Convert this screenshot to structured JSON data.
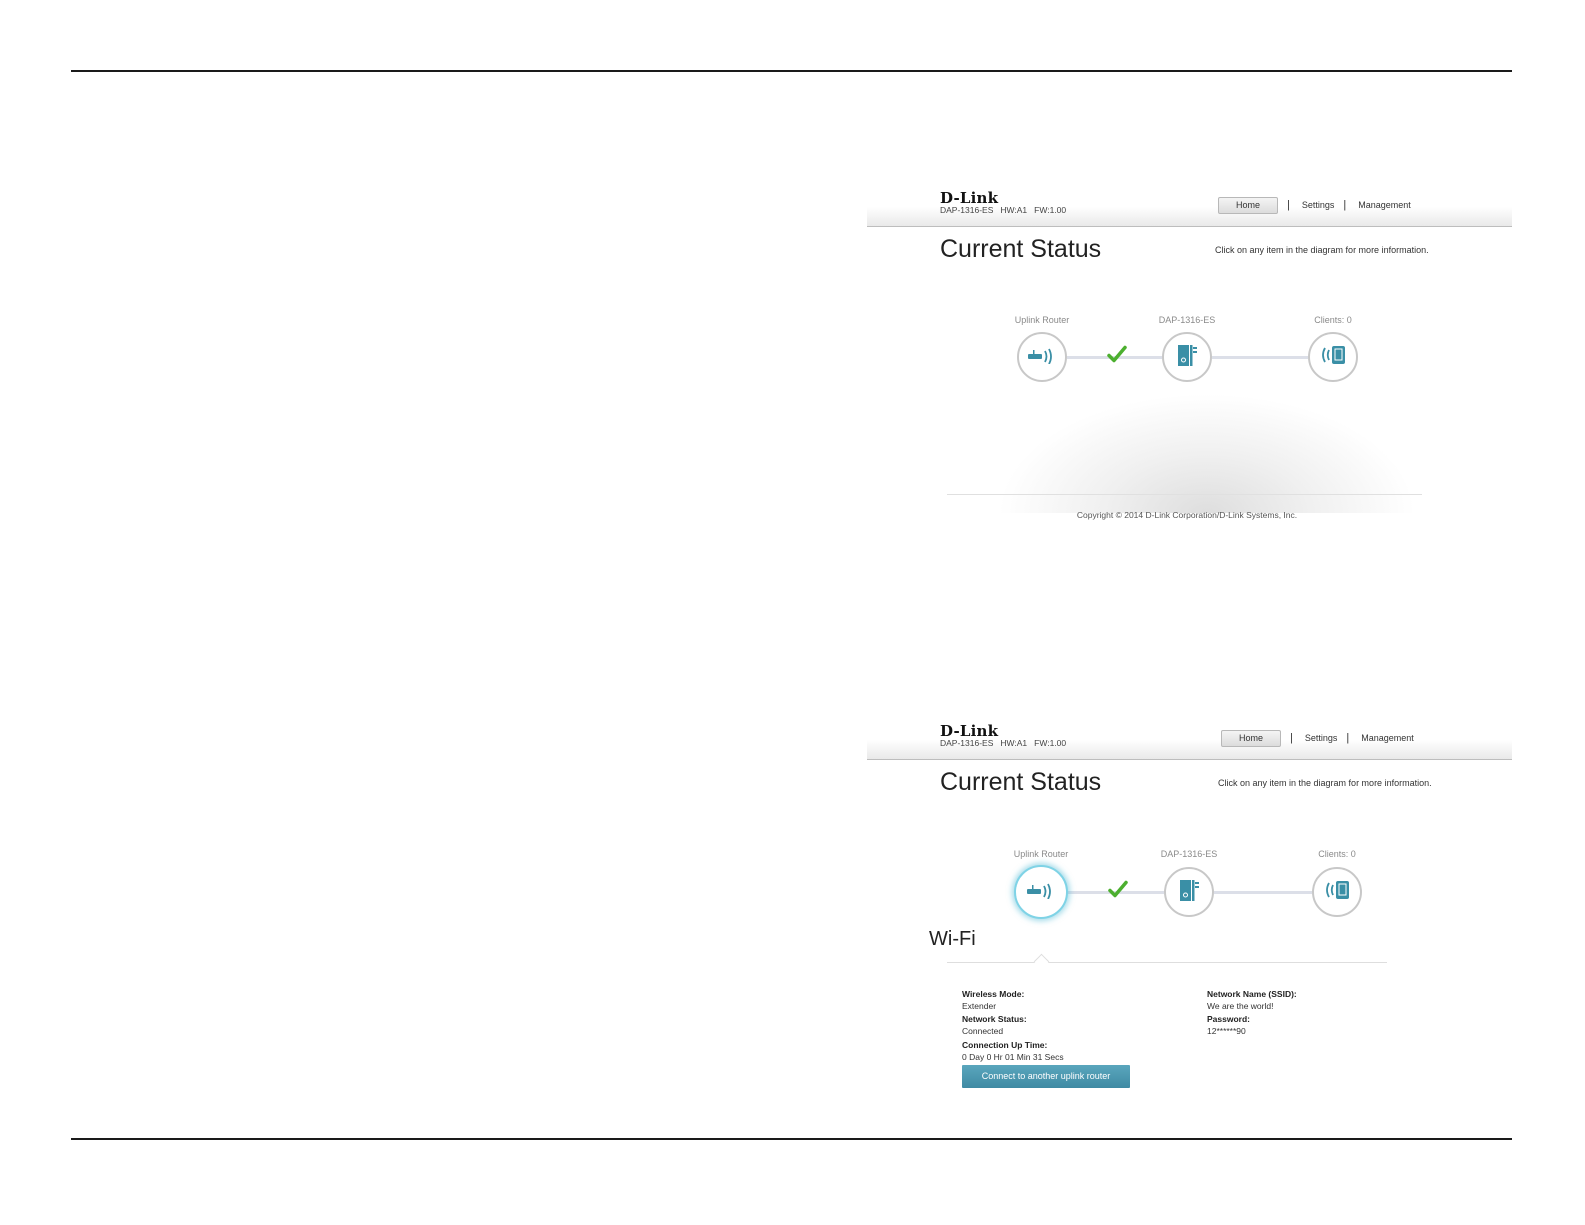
{
  "brand": {
    "logo": "D-Link",
    "model": "DAP-1316-ES",
    "hw": "HW:A1",
    "fw": "FW:1.00"
  },
  "nav": {
    "home": "Home",
    "settings": "Settings",
    "management": "Management",
    "separator": "|"
  },
  "page": {
    "title": "Current Status",
    "hint": "Click on any item in the diagram for more information."
  },
  "diagram": {
    "uplink_label": "Uplink Router",
    "device_label": "DAP-1316-ES",
    "clients_label": "Clients: 0",
    "uplink_icon": "router-icon",
    "device_icon": "extender-icon",
    "clients_icon": "wireless-client-icon",
    "connection_status_icon": "check-icon",
    "accent_color": "#3a8fa6",
    "check_color": "#4caf2f"
  },
  "footer": {
    "copyright": "Copyright © 2014 D-Link Corporation/D-Link Systems, Inc."
  },
  "wifi": {
    "title": "Wi-Fi",
    "wireless_mode_label": "Wireless Mode:",
    "wireless_mode_value": "Extender",
    "network_status_label": "Network Status:",
    "network_status_value": "Connected",
    "uptime_label": "Connection Up Time:",
    "uptime_value": "0 Day 0 Hr 01 Min 31 Secs",
    "ssid_label": "Network Name (SSID):",
    "ssid_value": "We are the world!",
    "password_label": "Password:",
    "password_value": "12******90",
    "connect_button": "Connect to another uplink router"
  }
}
